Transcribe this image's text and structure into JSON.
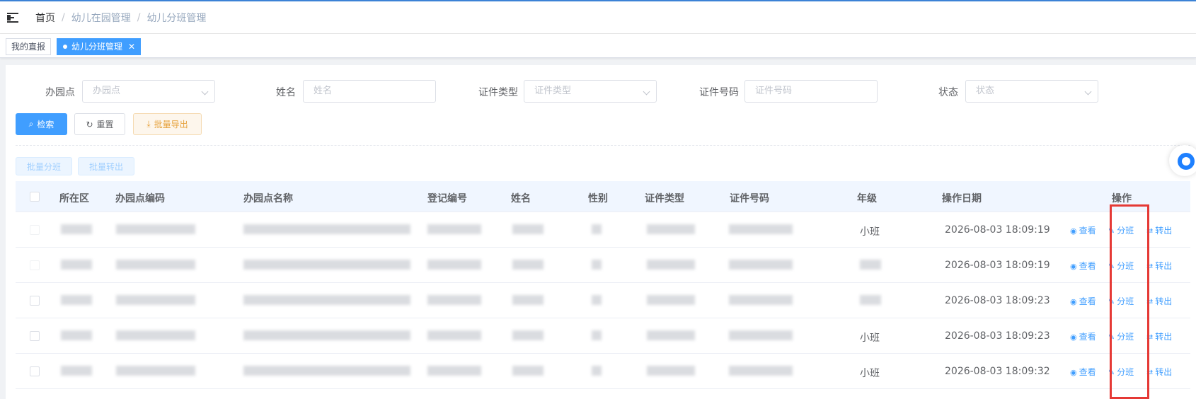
{
  "breadcrumb": [
    "首页",
    "幼儿在园管理",
    "幼儿分班管理"
  ],
  "tags": {
    "tag1": "我的直报",
    "tag2": "幼儿分班管理",
    "close": "✕"
  },
  "filters": {
    "campus": {
      "label": "办园点",
      "placeholder": "办园点"
    },
    "name": {
      "label": "姓名",
      "placeholder": "姓名"
    },
    "id_type": {
      "label": "证件类型",
      "placeholder": "证件类型"
    },
    "id_number": {
      "label": "证件号码",
      "placeholder": "证件号码"
    },
    "status": {
      "label": "状态",
      "placeholder": "状态"
    }
  },
  "buttons": {
    "search": "检索",
    "reset": "重置",
    "export": "批量导出",
    "batch_assign": "批量分班",
    "batch_transfer": "批量转出"
  },
  "icons": {
    "search": "search-icon",
    "reset": "refresh-icon",
    "export": "download-icon",
    "view": "eye-icon",
    "assign": "edit-icon",
    "transfer": "transfer-icon"
  },
  "table": {
    "headers": [
      "所在区",
      "办园点编码",
      "办园点名称",
      "登记编号",
      "姓名",
      "性别",
      "证件类型",
      "证件号码",
      "年级",
      "操作日期",
      "操作"
    ],
    "rows": [
      {
        "grade": "小班",
        "date": "2026-08-03 18:09:19"
      },
      {
        "grade": "",
        "date": "2026-08-03 18:09:19"
      },
      {
        "grade": "",
        "date": "2026-08-03 18:09:23"
      },
      {
        "grade": "小班",
        "date": "2026-08-03 18:09:23"
      },
      {
        "grade": "小班",
        "date": "2026-08-03 18:09:32"
      }
    ],
    "actions": {
      "view": "查看",
      "assign": "分班",
      "transfer": "转出"
    }
  },
  "colors": {
    "primary": "#409eff",
    "warning": "#e6a23c",
    "highlight_box": "#e53935",
    "header_bg": "#f0f6ff"
  }
}
